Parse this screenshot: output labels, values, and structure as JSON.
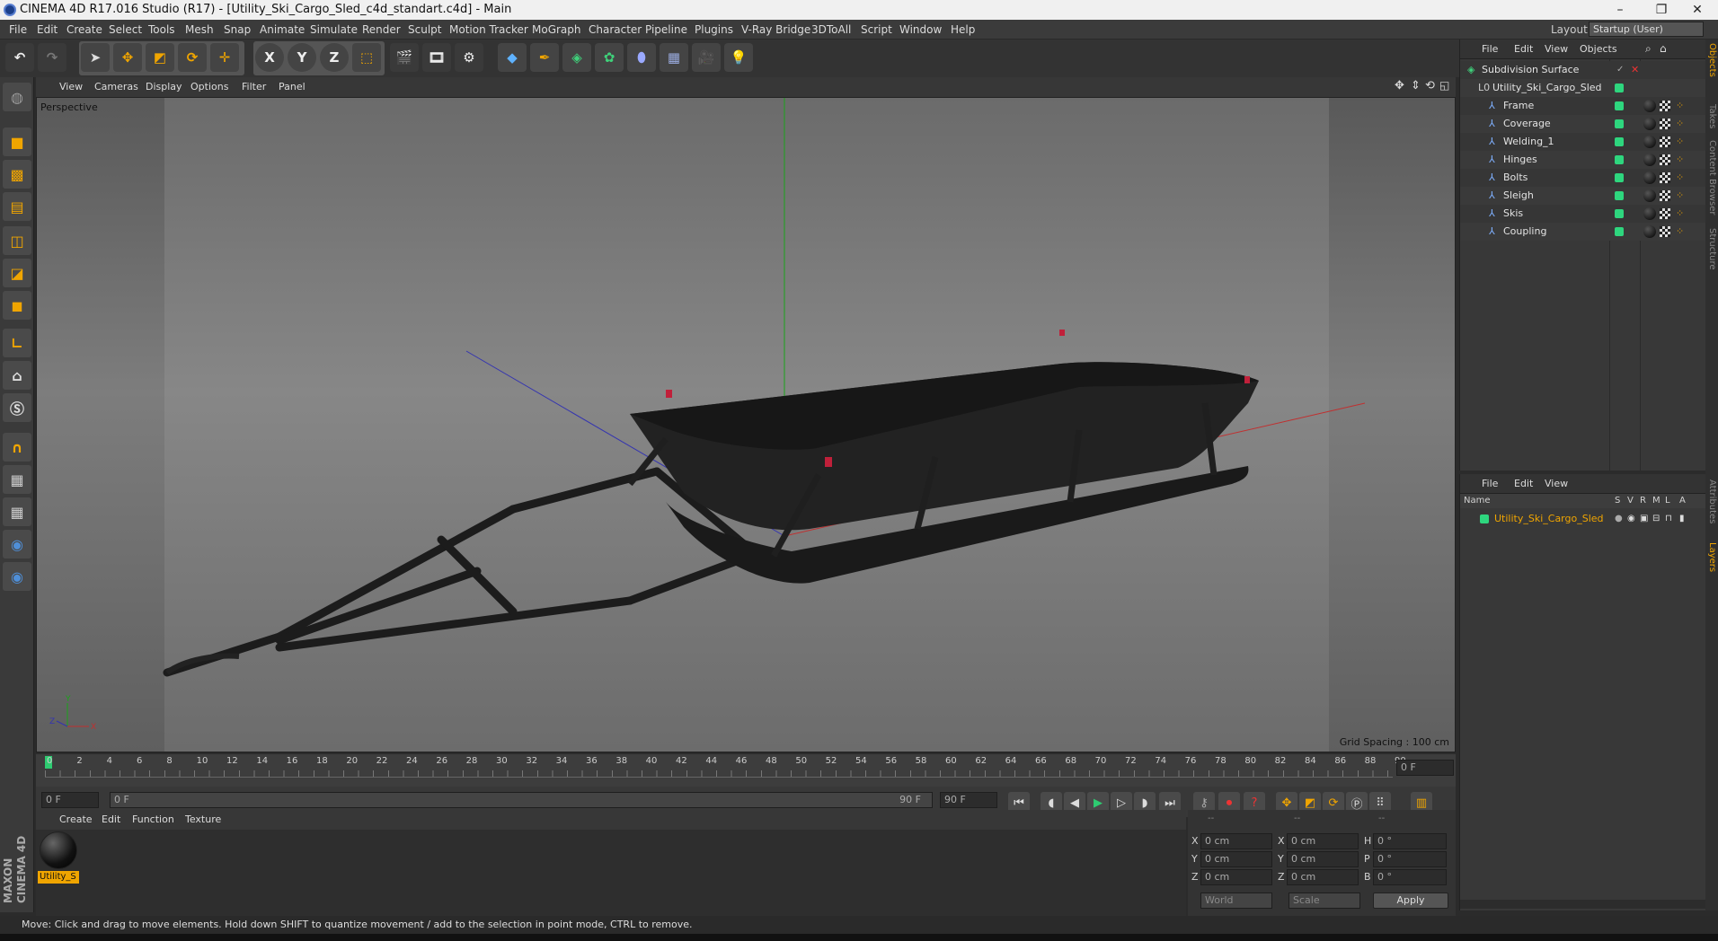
{
  "window": {
    "title": "CINEMA 4D R17.016 Studio (R17) - [Utility_Ski_Cargo_Sled_c4d_standart.c4d] - Main",
    "minimize": "–",
    "restore": "❐",
    "close": "✕"
  },
  "menubar": {
    "items": [
      "File",
      "Edit",
      "Create",
      "Select",
      "Tools",
      "Mesh",
      "Snap",
      "Animate",
      "Simulate",
      "Render",
      "Sculpt",
      "Motion Tracker",
      "MoGraph",
      "Character",
      "Pipeline",
      "Plugins",
      "V-Ray Bridge",
      "3DToAll",
      "Script",
      "Window",
      "Help"
    ],
    "layout_label": "Layout:",
    "layout_value": "Startup (User)"
  },
  "toolbar": {
    "x_label": "X",
    "y_label": "Y",
    "z_label": "Z"
  },
  "viewport": {
    "menu": [
      "View",
      "Cameras",
      "Display",
      "Options",
      "Filter",
      "Panel"
    ],
    "camera_label": "Perspective",
    "grid_spacing": "Grid Spacing : 100 cm"
  },
  "timeline": {
    "ticks": [
      "0",
      "2",
      "4",
      "6",
      "8",
      "10",
      "12",
      "14",
      "16",
      "18",
      "20",
      "22",
      "24",
      "26",
      "28",
      "30",
      "32",
      "34",
      "36",
      "38",
      "40",
      "42",
      "44",
      "46",
      "48",
      "50",
      "52",
      "54",
      "56",
      "58",
      "60",
      "62",
      "64",
      "66",
      "68",
      "70",
      "72",
      "74",
      "76",
      "78",
      "80",
      "82",
      "84",
      "86",
      "88",
      "90"
    ],
    "current_frame": "0 F",
    "start_field": "0 F",
    "range_start": "0 F",
    "range_end": "90 F",
    "end_field": "90 F"
  },
  "material": {
    "menu": [
      "Create",
      "Edit",
      "Function",
      "Texture"
    ],
    "item_label": "Utility_S"
  },
  "coords": {
    "headers": [
      "--",
      "--",
      "--"
    ],
    "rows": [
      {
        "a": "X",
        "av": "0 cm",
        "b": "X",
        "bv": "0 cm",
        "c": "H",
        "cv": "0 °"
      },
      {
        "a": "Y",
        "av": "0 cm",
        "b": "Y",
        "bv": "0 cm",
        "c": "P",
        "cv": "0 °"
      },
      {
        "a": "Z",
        "av": "0 cm",
        "b": "Z",
        "bv": "0 cm",
        "c": "B",
        "cv": "0 °"
      }
    ],
    "mode1": "World",
    "mode2": "Scale",
    "apply": "Apply"
  },
  "objects": {
    "menu": [
      "File",
      "Edit",
      "View",
      "Objects"
    ],
    "items": [
      {
        "name": "Subdivision Surface",
        "indent": 0
      },
      {
        "name": "Utility_Ski_Cargo_Sled",
        "indent": 1
      },
      {
        "name": "Frame",
        "indent": 2
      },
      {
        "name": "Coverage",
        "indent": 2
      },
      {
        "name": "Welding_1",
        "indent": 2
      },
      {
        "name": "Hinges",
        "indent": 2
      },
      {
        "name": "Bolts",
        "indent": 2
      },
      {
        "name": "Sleigh",
        "indent": 2
      },
      {
        "name": "Skis",
        "indent": 2
      },
      {
        "name": "Coupling",
        "indent": 2
      }
    ]
  },
  "layers": {
    "menu": [
      "File",
      "Edit",
      "View"
    ],
    "columns": [
      "Name",
      "S",
      "V",
      "R",
      "M",
      "L",
      "A"
    ],
    "item": "Utility_Ski_Cargo_Sled"
  },
  "side_tabs": [
    "Objects",
    "Takes",
    "Content Browser",
    "Structure",
    "Attributes",
    "Layers"
  ],
  "status": "Move: Click and drag to move elements. Hold down SHIFT to quantize movement / add to the selection in point mode, CTRL to remove.",
  "brand": "MAXON CINEMA 4D",
  "colors": {
    "accent": "#f0a500",
    "layer_green": "#2ed67e",
    "axis_x": "#c03030",
    "axis_y": "#1aa31a",
    "axis_z": "#3434b0"
  }
}
